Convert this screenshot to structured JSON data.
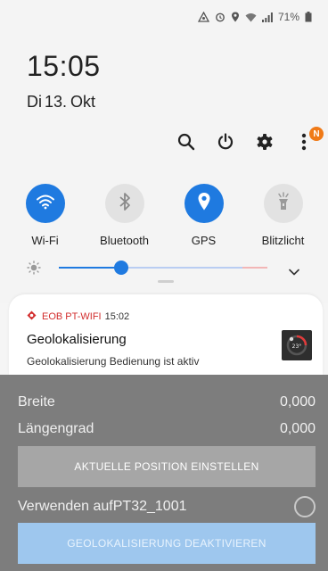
{
  "status_bar": {
    "battery": "71%"
  },
  "clock": {
    "time": "15:05",
    "day_name": "Di",
    "day": "13.",
    "month": "Okt"
  },
  "top_actions": {
    "badge": "N"
  },
  "tiles": [
    {
      "label": "Wi-Fi",
      "on": true
    },
    {
      "label": "Bluetooth",
      "on": false
    },
    {
      "label": "GPS",
      "on": true
    },
    {
      "label": "Blitzlicht",
      "on": false
    }
  ],
  "brightness": {
    "level": 0.3
  },
  "notification": {
    "app_name": "EOB PT-WIFI",
    "time": "15:02",
    "title": "Geolokalisierung",
    "body": "Geolokalisierung Bedienung ist aktiv",
    "thumb_text": "23°"
  },
  "app": {
    "latitude_label": "Breite",
    "latitude_value": "0,000",
    "longitude_label": "Längengrad",
    "longitude_value": "0,000",
    "set_position_button": "AKTUELLE POSITION EINSTELLEN",
    "use_on_label": "Verwenden aufPT32_1001",
    "deactivate_button": "GEOLOKALISIERUNG DEAKTIVIEREN"
  },
  "colors": {
    "accent": "#1f7ae0",
    "badge": "#f07a17",
    "app_red": "#d22d2d"
  }
}
